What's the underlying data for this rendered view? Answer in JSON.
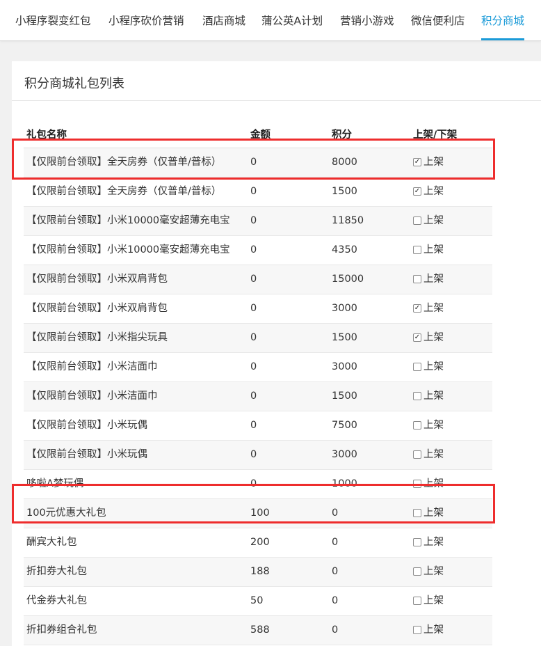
{
  "nav": {
    "tabs": [
      {
        "label": "小程序裂变红包",
        "active": false
      },
      {
        "label": "小程序砍价营销",
        "active": false
      },
      {
        "label": "酒店商城",
        "active": false
      },
      {
        "label": "蒲公英A计划",
        "active": false
      },
      {
        "label": "营销小游戏",
        "active": false
      },
      {
        "label": "微信便利店",
        "active": false
      },
      {
        "label": "积分商城",
        "active": true
      }
    ],
    "accent_color": "#1b9bd8"
  },
  "card": {
    "title": "积分商城礼包列表"
  },
  "table": {
    "headers": {
      "name": "礼包名称",
      "amount": "金额",
      "points": "积分",
      "status": "上架/下架"
    },
    "checkbox_label": "上架",
    "rows": [
      {
        "name": "【仅限前台领取】全天房券（仅普单/普标）",
        "amount": "0",
        "points": "8000",
        "listed": true
      },
      {
        "name": "【仅限前台领取】全天房券（仅普单/普标）",
        "amount": "0",
        "points": "1500",
        "listed": true
      },
      {
        "name": "【仅限前台领取】小米10000毫安超薄充电宝",
        "amount": "0",
        "points": "11850",
        "listed": false
      },
      {
        "name": "【仅限前台领取】小米10000毫安超薄充电宝",
        "amount": "0",
        "points": "4350",
        "listed": false
      },
      {
        "name": "【仅限前台领取】小米双肩背包",
        "amount": "0",
        "points": "15000",
        "listed": false
      },
      {
        "name": "【仅限前台领取】小米双肩背包",
        "amount": "0",
        "points": "3000",
        "listed": true
      },
      {
        "name": "【仅限前台领取】小米指尖玩具",
        "amount": "0",
        "points": "1500",
        "listed": true
      },
      {
        "name": "【仅限前台领取】小米洁面巾",
        "amount": "0",
        "points": "3000",
        "listed": false
      },
      {
        "name": "【仅限前台领取】小米洁面巾",
        "amount": "0",
        "points": "1500",
        "listed": false
      },
      {
        "name": "【仅限前台领取】小米玩偶",
        "amount": "0",
        "points": "7500",
        "listed": false
      },
      {
        "name": "【仅限前台领取】小米玩偶",
        "amount": "0",
        "points": "3000",
        "listed": false
      },
      {
        "name": "哆啦A梦玩偶",
        "amount": "0",
        "points": "1000",
        "listed": false
      },
      {
        "name": "100元优惠大礼包",
        "amount": "100",
        "points": "0",
        "listed": false
      },
      {
        "name": "酬宾大礼包",
        "amount": "200",
        "points": "0",
        "listed": false
      },
      {
        "name": "折扣券大礼包",
        "amount": "188",
        "points": "0",
        "listed": false
      },
      {
        "name": "代金券大礼包",
        "amount": "50",
        "points": "0",
        "listed": false
      },
      {
        "name": "折扣券组合礼包",
        "amount": "588",
        "points": "0",
        "listed": false
      }
    ]
  },
  "highlight_color": "#ee2d2d"
}
